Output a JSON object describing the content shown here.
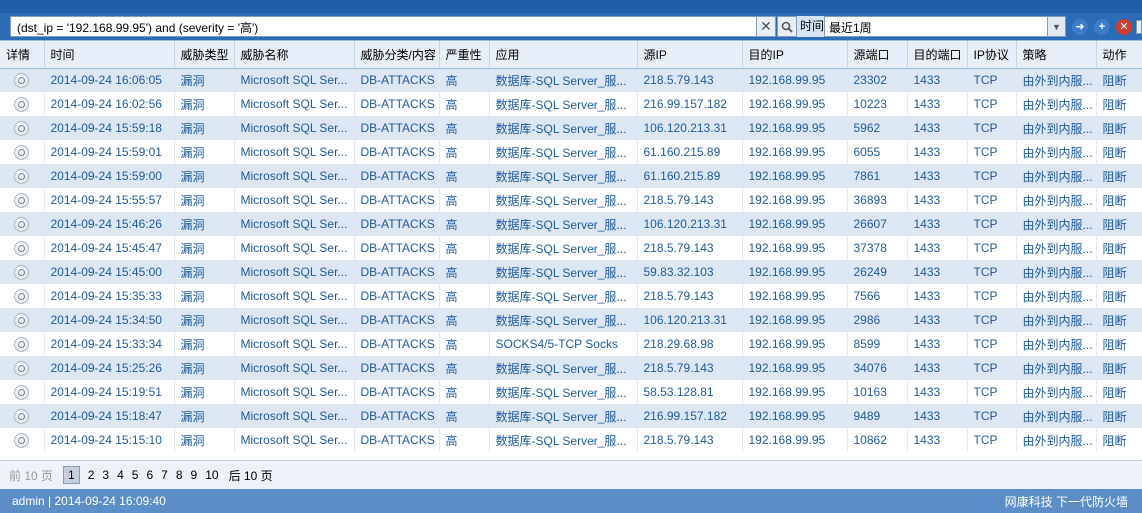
{
  "search": {
    "query": "(dst_ip = '192.168.99.95') and (severity = '高')",
    "time_label": "时间",
    "time_value": "最近1周"
  },
  "icons": {
    "clear": "close-icon",
    "search": "search-icon",
    "go": "arrow-right-icon",
    "add": "plus-icon",
    "remove": "remove-icon"
  },
  "colors": {
    "row_alt": "#dde7f4",
    "link": "#1d5a9e",
    "add_green": "#3a9a3a",
    "remove_red": "#d23c2a",
    "go_blue": "#3d7cc9"
  },
  "table": {
    "columns": [
      "详情",
      "时间",
      "威胁类型",
      "威胁名称",
      "威胁分类/内容",
      "严重性",
      "应用",
      "源IP",
      "目的IP",
      "源端口",
      "目的端口",
      "IP协议",
      "策略",
      "动作"
    ],
    "rows": [
      [
        "2014-09-24 16:06:05",
        "漏洞",
        "Microsoft SQL Ser...",
        "DB-ATTACKS",
        "高",
        "数据库-SQL Server_服...",
        "218.5.79.143",
        "192.168.99.95",
        "23302",
        "1433",
        "TCP",
        "由外到内服...",
        "阻断"
      ],
      [
        "2014-09-24 16:02:56",
        "漏洞",
        "Microsoft SQL Ser...",
        "DB-ATTACKS",
        "高",
        "数据库-SQL Server_服...",
        "216.99.157.182",
        "192.168.99.95",
        "10223",
        "1433",
        "TCP",
        "由外到内服...",
        "阻断"
      ],
      [
        "2014-09-24 15:59:18",
        "漏洞",
        "Microsoft SQL Ser...",
        "DB-ATTACKS",
        "高",
        "数据库-SQL Server_服...",
        "106.120.213.31",
        "192.168.99.95",
        "5962",
        "1433",
        "TCP",
        "由外到内服...",
        "阻断"
      ],
      [
        "2014-09-24 15:59:01",
        "漏洞",
        "Microsoft SQL Ser...",
        "DB-ATTACKS",
        "高",
        "数据库-SQL Server_服...",
        "61.160.215.89",
        "192.168.99.95",
        "6055",
        "1433",
        "TCP",
        "由外到内服...",
        "阻断"
      ],
      [
        "2014-09-24 15:59:00",
        "漏洞",
        "Microsoft SQL Ser...",
        "DB-ATTACKS",
        "高",
        "数据库-SQL Server_服...",
        "61.160.215.89",
        "192.168.99.95",
        "7861",
        "1433",
        "TCP",
        "由外到内服...",
        "阻断"
      ],
      [
        "2014-09-24 15:55:57",
        "漏洞",
        "Microsoft SQL Ser...",
        "DB-ATTACKS",
        "高",
        "数据库-SQL Server_服...",
        "218.5.79.143",
        "192.168.99.95",
        "36893",
        "1433",
        "TCP",
        "由外到内服...",
        "阻断"
      ],
      [
        "2014-09-24 15:46:26",
        "漏洞",
        "Microsoft SQL Ser...",
        "DB-ATTACKS",
        "高",
        "数据库-SQL Server_服...",
        "106.120.213.31",
        "192.168.99.95",
        "26607",
        "1433",
        "TCP",
        "由外到内服...",
        "阻断"
      ],
      [
        "2014-09-24 15:45:47",
        "漏洞",
        "Microsoft SQL Ser...",
        "DB-ATTACKS",
        "高",
        "数据库-SQL Server_服...",
        "218.5.79.143",
        "192.168.99.95",
        "37378",
        "1433",
        "TCP",
        "由外到内服...",
        "阻断"
      ],
      [
        "2014-09-24 15:45:00",
        "漏洞",
        "Microsoft SQL Ser...",
        "DB-ATTACKS",
        "高",
        "数据库-SQL Server_服...",
        "59.83.32.103",
        "192.168.99.95",
        "26249",
        "1433",
        "TCP",
        "由外到内服...",
        "阻断"
      ],
      [
        "2014-09-24 15:35:33",
        "漏洞",
        "Microsoft SQL Ser...",
        "DB-ATTACKS",
        "高",
        "数据库-SQL Server_服...",
        "218.5.79.143",
        "192.168.99.95",
        "7566",
        "1433",
        "TCP",
        "由外到内服...",
        "阻断"
      ],
      [
        "2014-09-24 15:34:50",
        "漏洞",
        "Microsoft SQL Ser...",
        "DB-ATTACKS",
        "高",
        "数据库-SQL Server_服...",
        "106.120.213.31",
        "192.168.99.95",
        "2986",
        "1433",
        "TCP",
        "由外到内服...",
        "阻断"
      ],
      [
        "2014-09-24 15:33:34",
        "漏洞",
        "Microsoft SQL Ser...",
        "DB-ATTACKS",
        "高",
        "SOCKS4/5-TCP Socks",
        "218.29.68.98",
        "192.168.99.95",
        "8599",
        "1433",
        "TCP",
        "由外到内服...",
        "阻断"
      ],
      [
        "2014-09-24 15:25:26",
        "漏洞",
        "Microsoft SQL Ser...",
        "DB-ATTACKS",
        "高",
        "数据库-SQL Server_服...",
        "218.5.79.143",
        "192.168.99.95",
        "34076",
        "1433",
        "TCP",
        "由外到内服...",
        "阻断"
      ],
      [
        "2014-09-24 15:19:51",
        "漏洞",
        "Microsoft SQL Ser...",
        "DB-ATTACKS",
        "高",
        "数据库-SQL Server_服...",
        "58.53.128.81",
        "192.168.99.95",
        "10163",
        "1433",
        "TCP",
        "由外到内服...",
        "阻断"
      ],
      [
        "2014-09-24 15:18:47",
        "漏洞",
        "Microsoft SQL Ser...",
        "DB-ATTACKS",
        "高",
        "数据库-SQL Server_服...",
        "216.99.157.182",
        "192.168.99.95",
        "9489",
        "1433",
        "TCP",
        "由外到内服...",
        "阻断"
      ],
      [
        "2014-09-24 15:15:10",
        "漏洞",
        "Microsoft SQL Ser...",
        "DB-ATTACKS",
        "高",
        "数据库-SQL Server_服...",
        "218.5.79.143",
        "192.168.99.95",
        "10862",
        "1433",
        "TCP",
        "由外到内服...",
        "阻断"
      ]
    ]
  },
  "pager": {
    "prev": "前 10 页",
    "pages": [
      "1",
      "2",
      "3",
      "4",
      "5",
      "6",
      "7",
      "8",
      "9",
      "10"
    ],
    "current": "1",
    "next": "后 10 页"
  },
  "status": {
    "left": "admin | 2014-09-24 16:09:40",
    "right": "网康科技 下一代防火墙"
  }
}
